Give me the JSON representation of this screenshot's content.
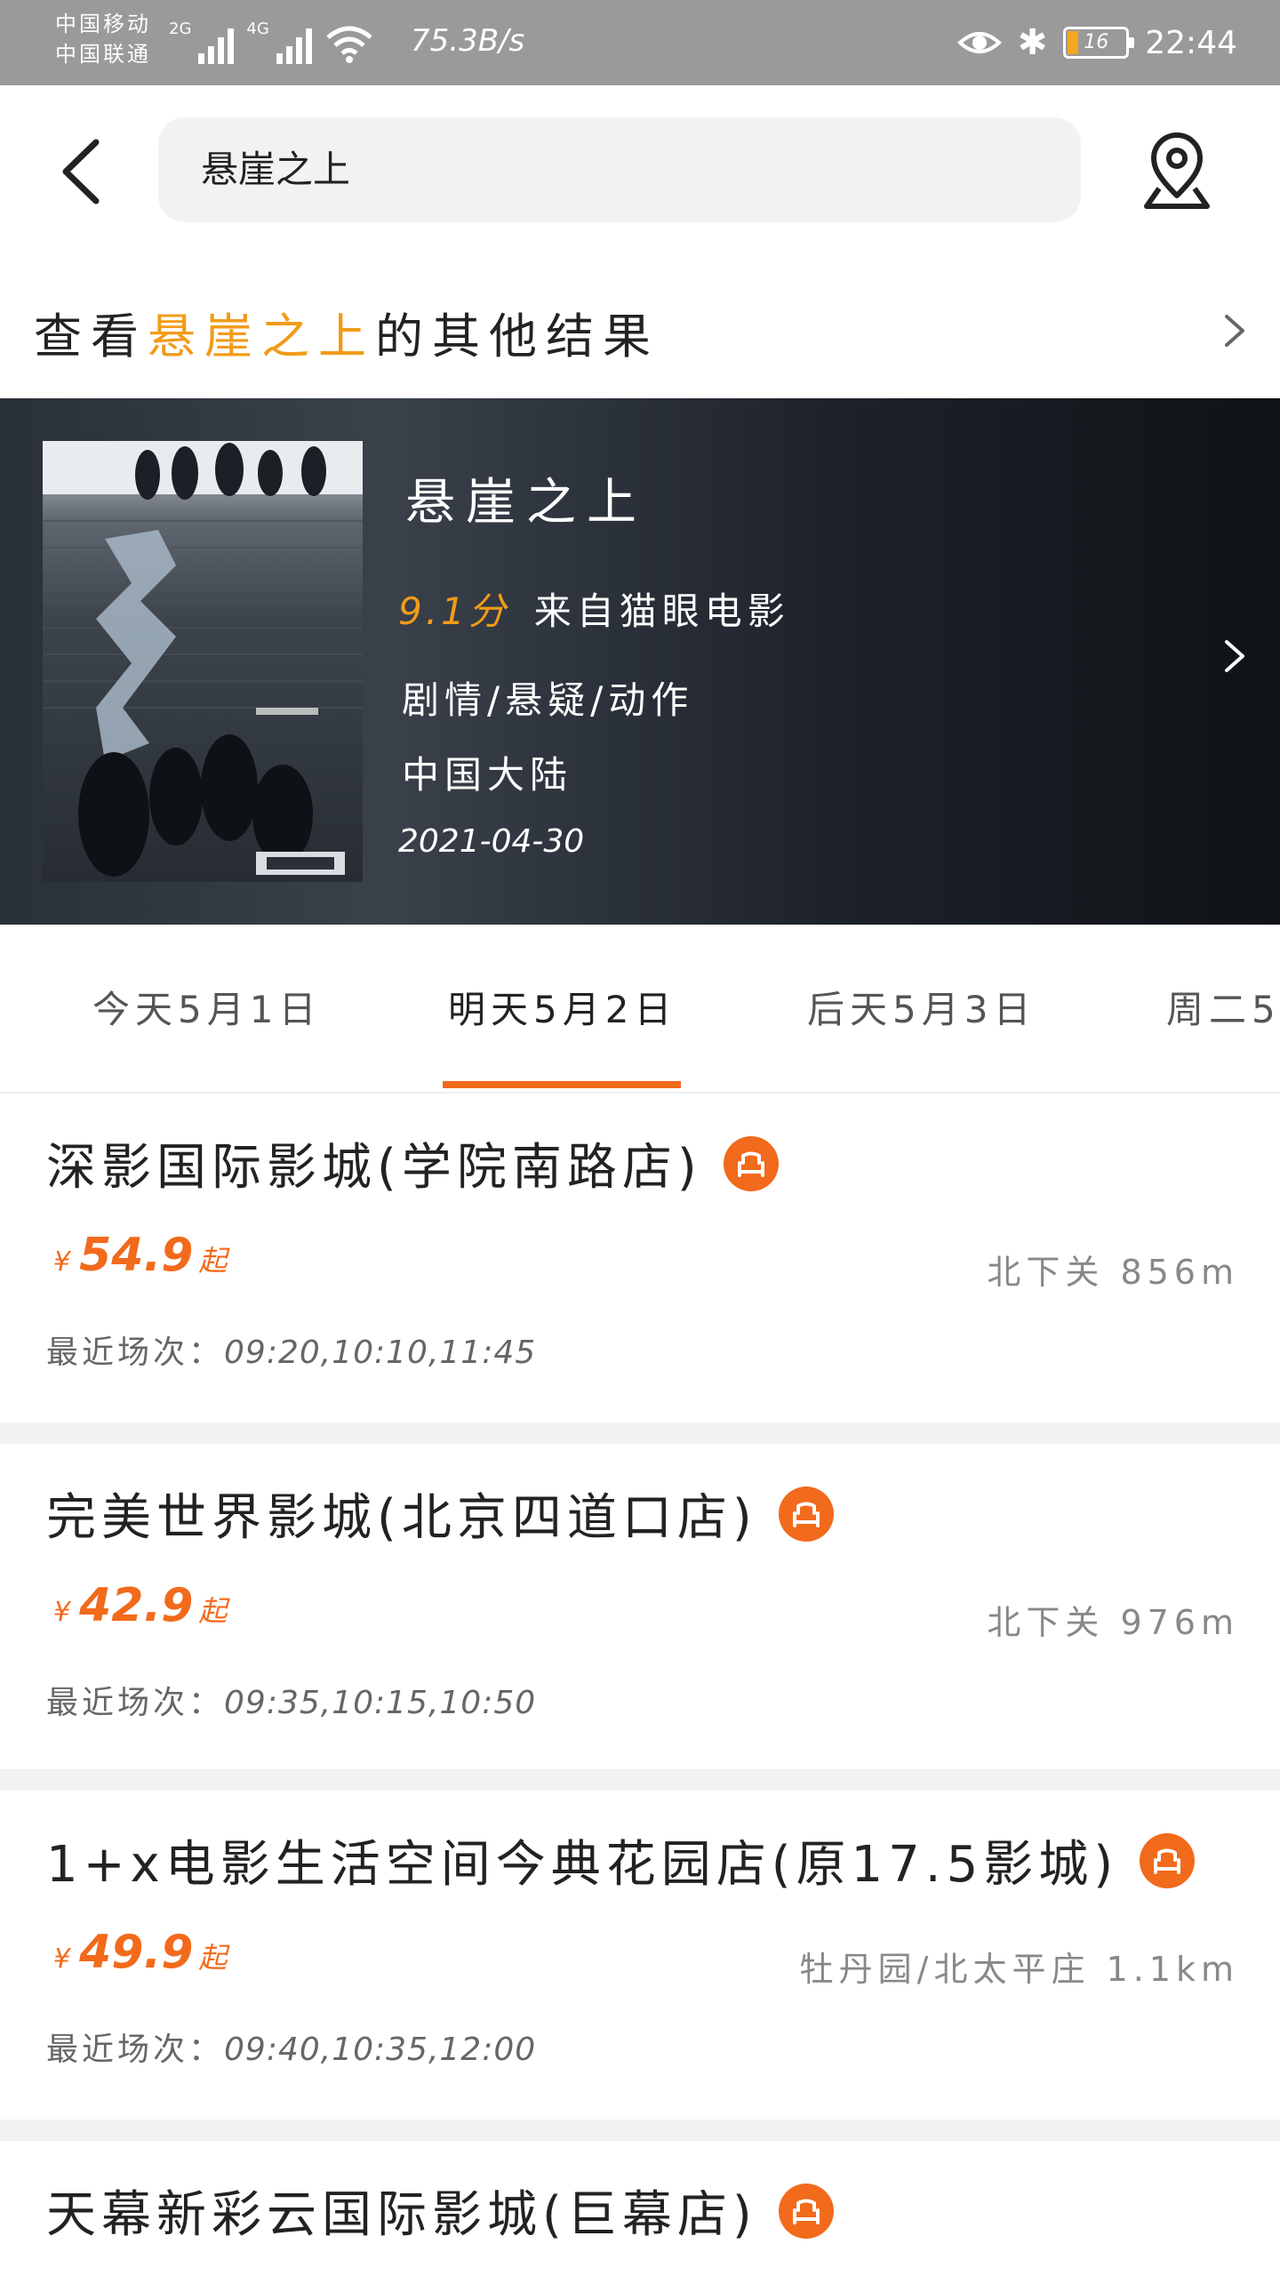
{
  "status_bar": {
    "carrier_1": "中国移动",
    "carrier_2": "中国联通",
    "net_1": "2G",
    "net_2": "4G",
    "speed": "75.3B/s",
    "battery": "16",
    "time": "22:44"
  },
  "search": {
    "query": "悬崖之上"
  },
  "other_results": {
    "prefix": "查看",
    "keyword": "悬崖之上",
    "suffix": "的其他结果"
  },
  "movie": {
    "title": "悬崖之上",
    "rating": "9.1分",
    "source": "来自猫眼电影",
    "genre": "剧情/悬疑/动作",
    "region": "中国大陆",
    "release_date": "2021-04-30"
  },
  "date_tabs": [
    {
      "label": "今天5月1日"
    },
    {
      "label": "明天5月2日"
    },
    {
      "label": "后天5月3日"
    },
    {
      "label": "周二5"
    }
  ],
  "cinemas": [
    {
      "name": "深影国际影城(学院南路店)",
      "currency": "¥",
      "price": "54.9",
      "from": "起",
      "distance": "北下关 856m",
      "showtimes_label": "最近场次：",
      "showtimes": "09:20,10:10,11:45"
    },
    {
      "name": "完美世界影城(北京四道口店)",
      "currency": "¥",
      "price": "42.9",
      "from": "起",
      "distance": "北下关 976m",
      "showtimes_label": "最近场次：",
      "showtimes": "09:35,10:15,10:50"
    },
    {
      "name": "1+x电影生活空间今典花园店(原17.5影城)",
      "currency": "¥",
      "price": "49.9",
      "from": "起",
      "distance": "牡丹园/北太平庄 1.1km",
      "showtimes_label": "最近场次：",
      "showtimes": "09:40,10:35,12:00"
    },
    {
      "name": "天幕新彩云国际影城(巨幕店)"
    }
  ],
  "colors": {
    "accent": "#f26a1b",
    "highlight": "#f29b18"
  }
}
